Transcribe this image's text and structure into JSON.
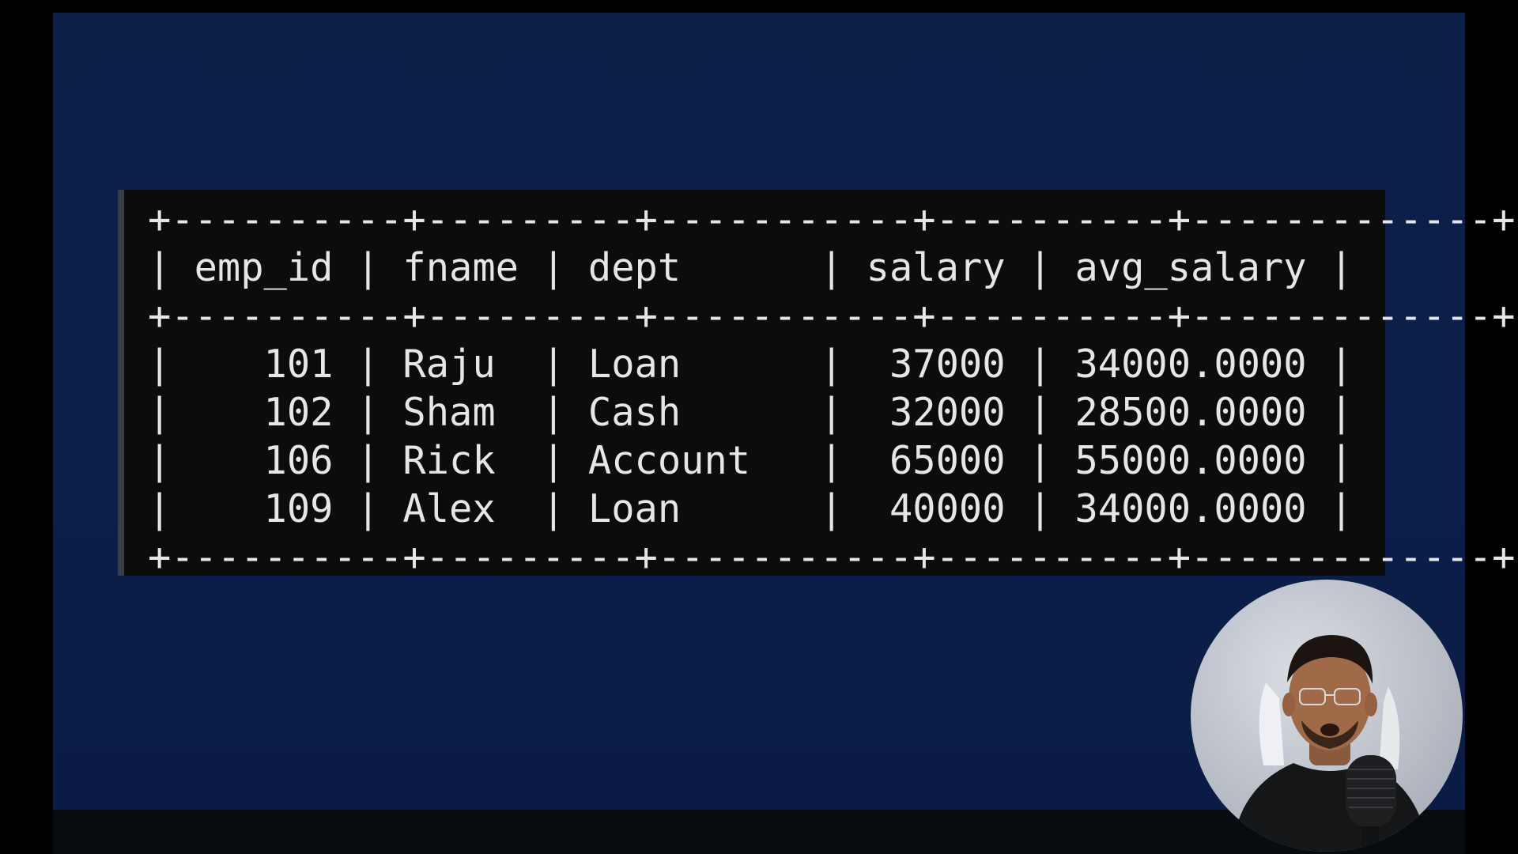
{
  "table": {
    "border": "+----------+---------+-----------+----------+-------------+",
    "header": "| emp_id | fname | dept      | salary | avg_salary |",
    "rows": [
      "|    101 | Raju  | Loan      |  37000 | 34000.0000 |",
      "|    102 | Sham  | Cash      |  32000 | 28500.0000 |",
      "|    106 | Rick  | Account   |  65000 | 55000.0000 |",
      "|    109 | Alex  | Loan      |  40000 | 34000.0000 |"
    ],
    "columns": [
      "emp_id",
      "fname",
      "dept",
      "salary",
      "avg_salary"
    ],
    "data": [
      [
        "101",
        "Raju",
        "Loan",
        "37000",
        "34000.0000"
      ],
      [
        "102",
        "Sham",
        "Cash",
        "32000",
        "28500.0000"
      ],
      [
        "106",
        "Rick",
        "Account",
        "65000",
        "55000.0000"
      ],
      [
        "109",
        "Alex",
        "Loan",
        "40000",
        "34000.0000"
      ]
    ]
  },
  "colors": {
    "slide_background": "#0b1f4a",
    "terminal_background": "#0c0c0c",
    "terminal_text": "#e6e6e6",
    "outer_background": "#000000"
  },
  "icons": {
    "presenter": "person-icon",
    "microphone": "microphone-icon"
  }
}
